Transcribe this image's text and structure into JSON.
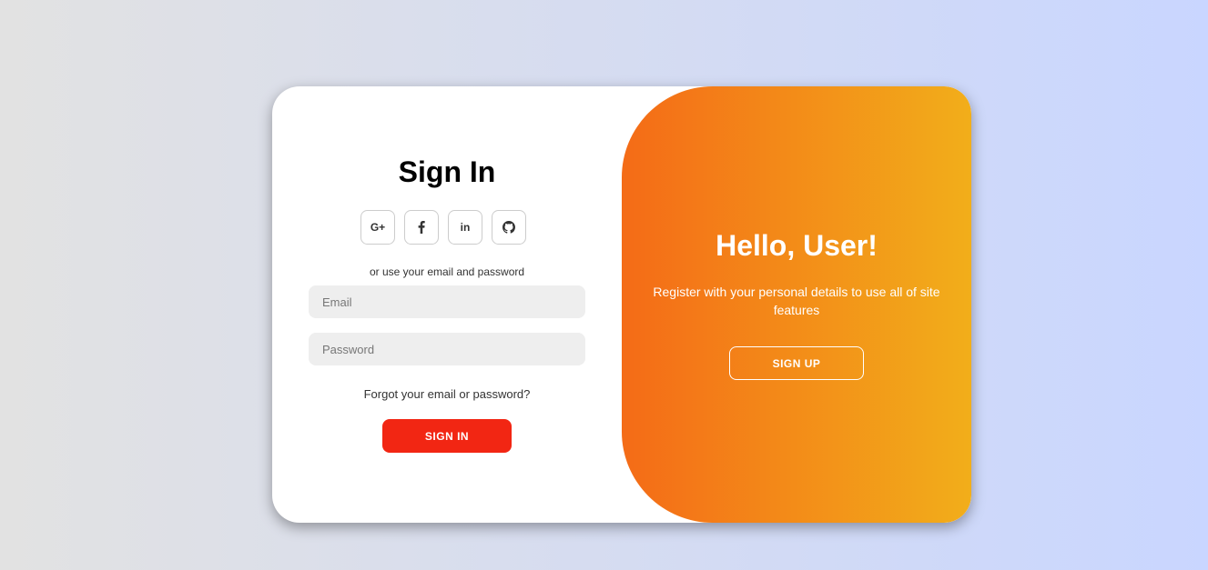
{
  "signin": {
    "title": "Sign In",
    "social_buttons": [
      {
        "icon": "google-plus-icon",
        "label": "G+"
      },
      {
        "icon": "facebook-icon",
        "label": "f"
      },
      {
        "icon": "linkedin-icon",
        "label": "in"
      },
      {
        "icon": "github-icon",
        "label": ""
      }
    ],
    "alt_text": "or use your email and password",
    "email_placeholder": "Email",
    "password_placeholder": "Password",
    "forgot_link": "Forgot your email or password?",
    "submit_label": "SIGN IN"
  },
  "panel": {
    "title": "Hello, User!",
    "description": "Register with your personal details to use all of site features",
    "button_label": "SIGN UP"
  },
  "colors": {
    "background_gradient": [
      "#e2e2e2",
      "#c9d6ff"
    ],
    "panel_gradient": [
      "#f46b17",
      "#f2ae1a"
    ],
    "signin_button": "#f22613",
    "input_background": "#eeeeee"
  }
}
